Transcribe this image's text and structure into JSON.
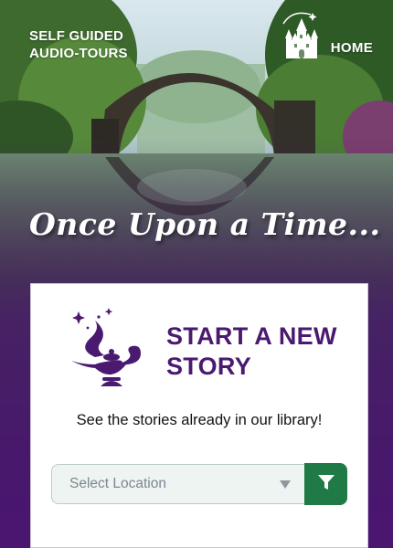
{
  "header": {
    "brand_line1": "SELF GUIDED",
    "brand_line2": "AUDIO-TOURS",
    "home_label": "HOME",
    "home_icon": "castle-icon"
  },
  "hero": {
    "title": "Once Upon a Time..."
  },
  "card": {
    "icon": "magic-lamp-icon",
    "title_line1": "START A NEW",
    "title_line2": "STORY",
    "subtitle": "See the stories already in our library!",
    "location_select": {
      "selected": "Select Location"
    },
    "filter_icon": "filter-icon"
  },
  "colors": {
    "accent_purple": "#4a1a70",
    "filter_green": "#1f7a45",
    "background_purple": "#4a1670"
  }
}
